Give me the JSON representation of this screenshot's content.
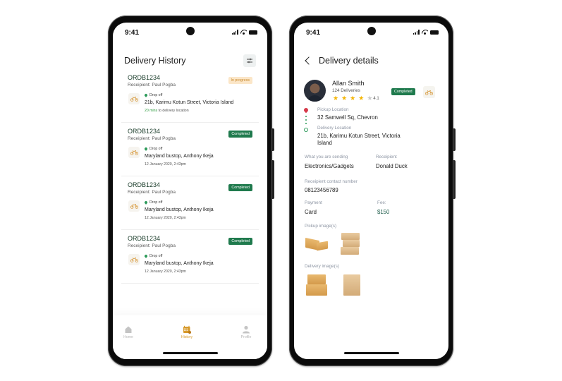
{
  "status_bar": {
    "time": "9:41"
  },
  "history_screen": {
    "title": "Delivery History",
    "filter_icon": "sliders-icon",
    "orders": [
      {
        "order_id": "ORDB1234",
        "recipient": "Receipient: Paul Pogba",
        "status": "In progress",
        "status_type": "progress",
        "drop_label": "Drop off",
        "address": "21b, Karimu Kotun Street, Victoria Island",
        "eta_highlight": "20 mins",
        "eta_text": " to delivery location"
      },
      {
        "order_id": "ORDB1234",
        "recipient": "Receipient: Paul Pogba",
        "status": "Completed",
        "status_type": "completed",
        "drop_label": "Drop off",
        "address": "Maryland bustop, Anthony Ikeja",
        "date": "12 January 2020, 2:43pm"
      },
      {
        "order_id": "ORDB1234",
        "recipient": "Receipient: Paul Pogba",
        "status": "Completed",
        "status_type": "completed",
        "drop_label": "Drop off",
        "address": "Maryland bustop, Anthony Ikeja",
        "date": "12 January 2020, 2:43pm"
      },
      {
        "order_id": "ORDB1234",
        "recipient": "Receipient: Paul Pogba",
        "status": "Completed",
        "status_type": "completed",
        "drop_label": "Drop off",
        "address": "Maryland bustop, Anthony Ikeja",
        "date": "12 January 2020, 2:43pm"
      }
    ],
    "tabbar": [
      {
        "label": "Home",
        "icon": "home-icon",
        "active": false
      },
      {
        "label": "History",
        "icon": "calendar-icon",
        "active": true
      },
      {
        "label": "Profile",
        "icon": "user-icon",
        "active": false
      }
    ]
  },
  "details_screen": {
    "title": "Delivery details",
    "driver": {
      "name": "Allan Smith",
      "deliveries": "124 Deliveries",
      "rating": "4.1",
      "stars_filled": 4,
      "stars_total": 5
    },
    "status": "Completed",
    "pickup_label": "Pickup Location",
    "pickup_value": "32 Samwell Sq, Chevron",
    "delivery_label": "Delivery Location",
    "delivery_value": "21b, Karimu Kotun Street, Victoria Island",
    "sending_label": "What you are sending",
    "sending_value": "Electronics/Gadgets",
    "recipient_label": "Receipient",
    "recipient_value": "Donald Duck",
    "contact_label": "Receipient contact number",
    "contact_value": "08123456789",
    "payment_label": "Payment",
    "payment_value": "Card",
    "fee_label": "Fee:",
    "fee_value": "$150",
    "pickup_images_label": "Pickup image(s)",
    "delivery_images_label": "Delivery image(s)"
  },
  "colors": {
    "brand_green": "#1f7a4d",
    "accent_orange": "#d79a2b",
    "progress_bg": "#fbe6c8"
  }
}
